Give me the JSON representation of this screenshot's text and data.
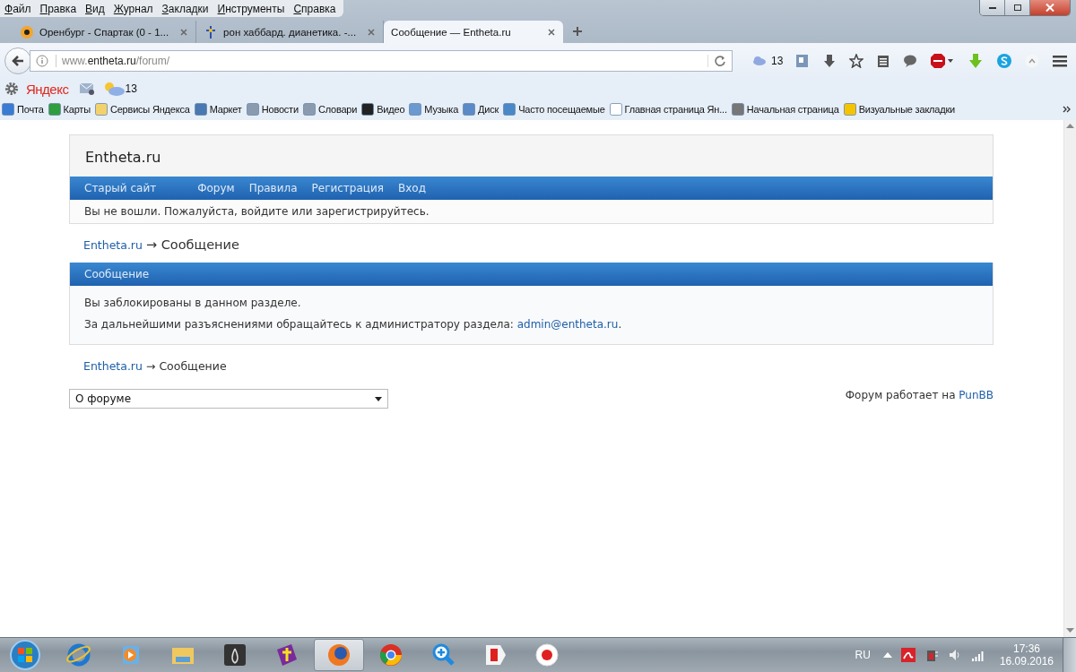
{
  "menu_bar": [
    "Файл",
    "Правка",
    "Вид",
    "Журнал",
    "Закладки",
    "Инструменты",
    "Справка"
  ],
  "tabs": [
    {
      "label": "Оренбург - Спартак (0 - 1...",
      "selected": false
    },
    {
      "label": "рон хаббард. дианетика. -...",
      "selected": false
    },
    {
      "label": "Сообщение — Entheta.ru",
      "selected": true
    }
  ],
  "address_bar": {
    "url_prefix": "www.",
    "url_host": "entheta.ru",
    "url_path": "/forum/"
  },
  "toolbar": {
    "weather_reading": "13"
  },
  "yandex_bar": {
    "logo": "Яндекс",
    "weather_reading": "13"
  },
  "bookmarks": [
    "Почта",
    "Карты",
    "Сервисы Яндекса",
    "Маркет",
    "Новости",
    "Словари",
    "Видео",
    "Музыка",
    "Диск",
    "Часто посещаемые",
    "Главная страница Ян...",
    "Начальная страница",
    "Визуальные закладки"
  ],
  "page": {
    "site_title": "Entheta.ru",
    "nav": [
      "Старый сайт",
      "Форум",
      "Правила",
      "Регистрация",
      "Вход"
    ],
    "status_message": "Вы не вошли. Пожалуйста, войдите или зарегистрируйтесь.",
    "breadcrumb_top": {
      "link": "Entheta.ru",
      "current": "→ Сообщение"
    },
    "message": {
      "heading": "Сообщение",
      "text": "Вы заблокированы в данном разделе.",
      "contact_text": "За дальнейшими разъяснениями обращайтесь к администратору раздела: ",
      "contact_link": "admin@entheta.ru",
      "contact_end": "."
    },
    "breadcrumb_bottom": {
      "link": "Entheta.ru",
      "current": "→ Сообщение"
    },
    "jump_select": "О форуме",
    "powered_text": "Форум работает на ",
    "powered_link": "PunBB"
  },
  "taskbar": {
    "apps": [
      {
        "selected": false
      },
      {
        "selected": false
      },
      {
        "selected": false
      },
      {
        "selected": false
      },
      {
        "selected": false
      },
      {
        "selected": true
      },
      {
        "selected": false
      },
      {
        "selected": false
      },
      {
        "selected": false
      },
      {
        "selected": false
      }
    ],
    "language": "RU",
    "time": "17:36",
    "date": "16.09.2016"
  }
}
